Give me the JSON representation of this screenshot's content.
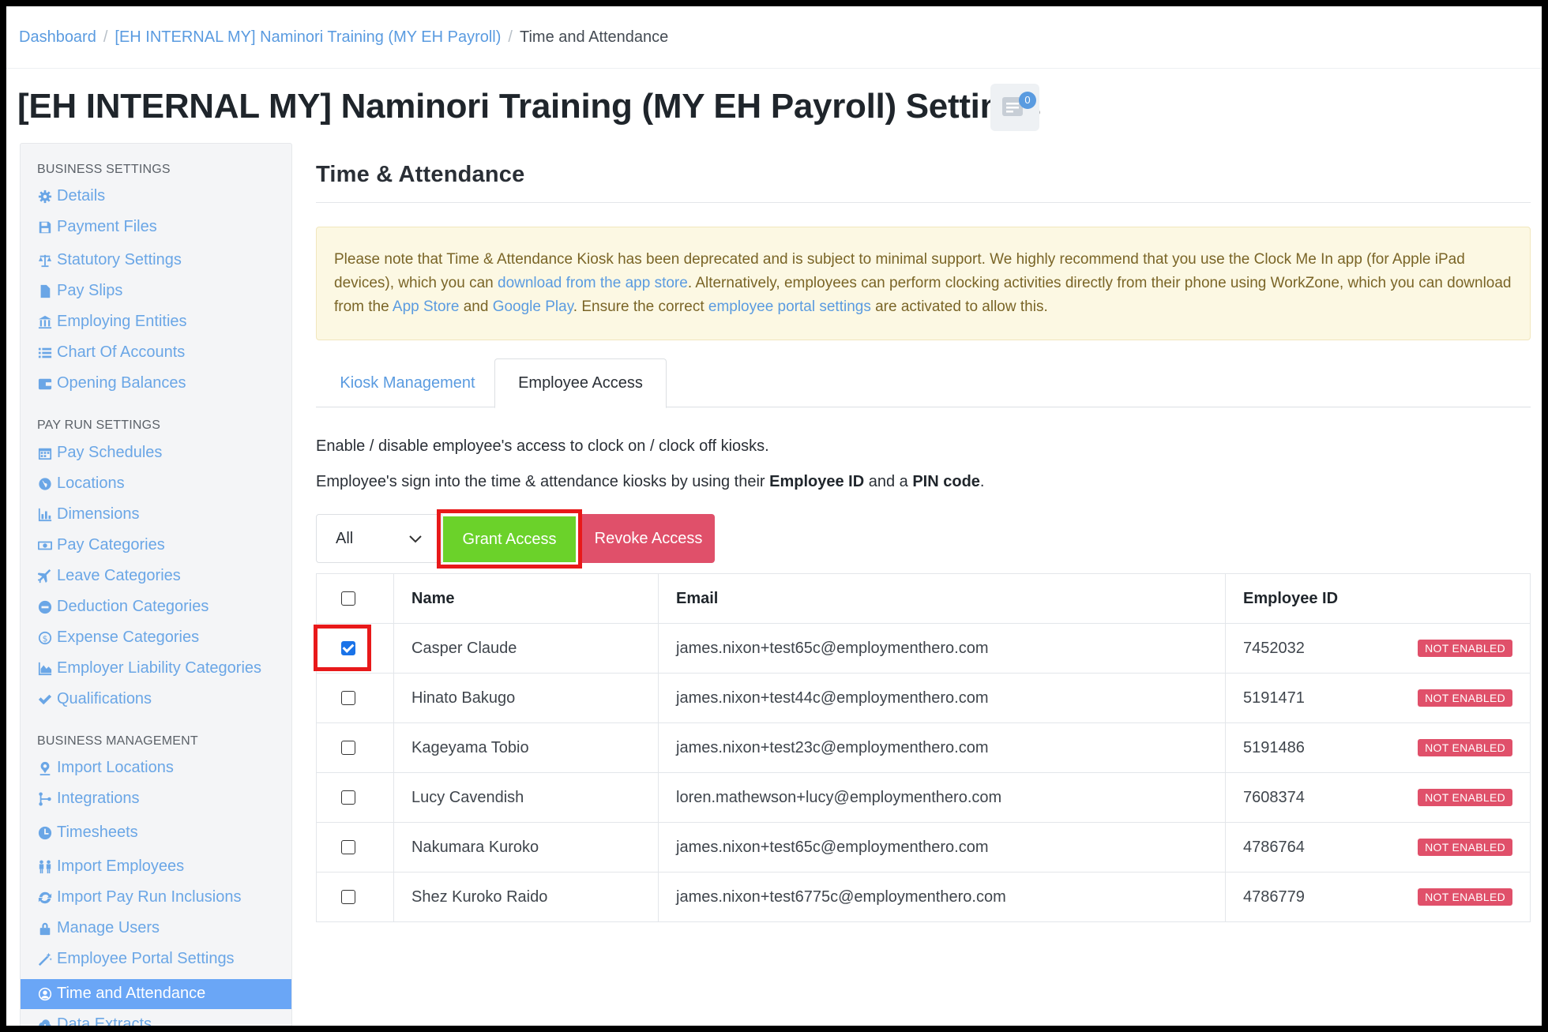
{
  "breadcrumb": {
    "items": [
      "Dashboard",
      "[EH INTERNAL MY] Naminori Training (MY EH Payroll)"
    ],
    "current": "Time and Attendance"
  },
  "page": {
    "title": "[EH INTERNAL MY] Naminori Training (MY EH Payroll) Settings",
    "notes_count": "0"
  },
  "sidebar": {
    "business_settings": {
      "heading": "BUSINESS SETTINGS",
      "items": [
        {
          "label": "Details",
          "icon": "gear-icon"
        },
        {
          "label": "Payment Files",
          "icon": "save-icon"
        },
        {
          "label": "Statutory Settings",
          "icon": "scale-icon"
        },
        {
          "label": "Pay Slips",
          "icon": "file-icon"
        },
        {
          "label": "Employing Entities",
          "icon": "bank-icon"
        },
        {
          "label": "Chart Of Accounts",
          "icon": "list-icon"
        },
        {
          "label": "Opening Balances",
          "icon": "wallet-icon"
        }
      ]
    },
    "pay_run_settings": {
      "heading": "PAY RUN SETTINGS",
      "items": [
        {
          "label": "Pay Schedules",
          "icon": "calendar-icon"
        },
        {
          "label": "Locations",
          "icon": "globe-icon"
        },
        {
          "label": "Dimensions",
          "icon": "bar-chart-icon"
        },
        {
          "label": "Pay Categories",
          "icon": "money-icon"
        },
        {
          "label": "Leave Categories",
          "icon": "plane-icon"
        },
        {
          "label": "Deduction Categories",
          "icon": "minus-circle-icon"
        },
        {
          "label": "Expense Categories",
          "icon": "dollar-circle-icon"
        },
        {
          "label": "Employer Liability Categories",
          "icon": "area-chart-icon"
        },
        {
          "label": "Qualifications",
          "icon": "check-icon"
        }
      ]
    },
    "business_management": {
      "heading": "BUSINESS MANAGEMENT",
      "items": [
        {
          "label": "Import Locations",
          "icon": "map-pin-icon"
        },
        {
          "label": "Integrations",
          "icon": "plug-icon"
        },
        {
          "label": "Timesheets",
          "icon": "clock-icon"
        },
        {
          "label": "Import Employees",
          "icon": "users-icon"
        },
        {
          "label": "Import Pay Run Inclusions",
          "icon": "refresh-icon"
        },
        {
          "label": "Manage Users",
          "icon": "lock-icon"
        },
        {
          "label": "Employee Portal Settings",
          "icon": "magic-wand-icon"
        },
        {
          "label": "Time and Attendance",
          "icon": "user-circle-icon"
        },
        {
          "label": "Data Extracts",
          "icon": "cloud-download-icon"
        }
      ]
    }
  },
  "main": {
    "section_title": "Time & Attendance",
    "alert": {
      "t1": "Please note that Time & Attendance Kiosk has been deprecated and is subject to minimal support. We highly recommend that you use the Clock Me In app (for Apple iPad devices), which you can ",
      "link1": "download from the app store",
      "t2": ". Alternatively, employees can perform clocking activities directly from their phone using WorkZone, which you can download from the ",
      "link2": "App Store",
      "t3": " and ",
      "link3": "Google Play",
      "t4": ". Ensure the correct ",
      "link4": "employee portal settings",
      "t5": " are activated to allow this."
    },
    "tabs": [
      "Kiosk Management",
      "Employee Access"
    ],
    "para1": "Enable / disable employee's access to clock on / clock off kiosks.",
    "para2": {
      "a": "Employee's sign into the time & attendance kiosks by using their ",
      "b": "Employee ID",
      "c": " and a ",
      "d": "PIN code",
      "e": "."
    },
    "filter_value": "All",
    "grant_label": "Grant Access",
    "revoke_label": "Revoke Access",
    "table": {
      "headers": [
        "Name",
        "Email",
        "Employee ID"
      ],
      "rows": [
        {
          "name": "Casper Claude",
          "email": "james.nixon+test65c@employmenthero.com",
          "id": "7452032",
          "status": "NOT ENABLED",
          "checked": true
        },
        {
          "name": "Hinato Bakugo",
          "email": "james.nixon+test44c@employmenthero.com",
          "id": "5191471",
          "status": "NOT ENABLED",
          "checked": false
        },
        {
          "name": "Kageyama Tobio",
          "email": "james.nixon+test23c@employmenthero.com",
          "id": "5191486",
          "status": "NOT ENABLED",
          "checked": false
        },
        {
          "name": "Lucy Cavendish",
          "email": "loren.mathewson+lucy@employmenthero.com",
          "id": "7608374",
          "status": "NOT ENABLED",
          "checked": false
        },
        {
          "name": "Nakumara Kuroko",
          "email": "james.nixon+test65c@employmenthero.com",
          "id": "4786764",
          "status": "NOT ENABLED",
          "checked": false
        },
        {
          "name": "Shez Kuroko Raido",
          "email": "james.nixon+test6775c@employmenthero.com",
          "id": "4786779",
          "status": "NOT ENABLED",
          "checked": false
        }
      ]
    }
  },
  "colors": {
    "link": "#5a9be0",
    "grant": "#6bd22a",
    "revoke": "#e0506a",
    "active_nav": "#6aa6f6",
    "highlight": "#e8191a"
  }
}
